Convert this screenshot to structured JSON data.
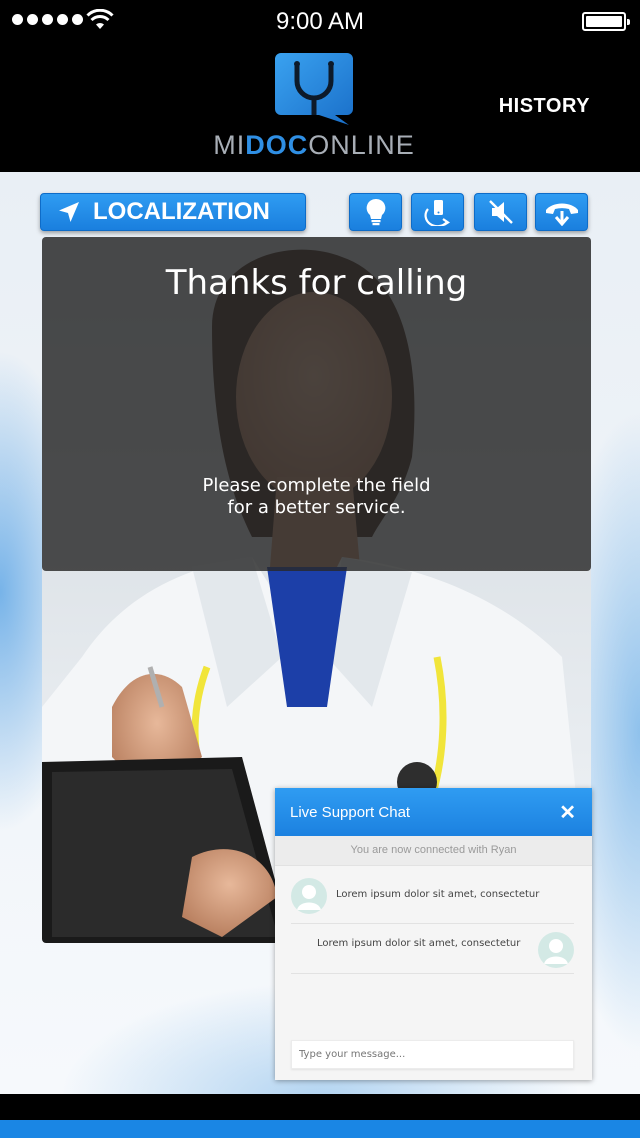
{
  "status_bar": {
    "time": "9:00 AM"
  },
  "header": {
    "logo_parts": [
      "MI",
      "DOC",
      "ONLINE"
    ],
    "history_label": "HISTORY"
  },
  "toolbar": {
    "localization_label": "LOCALIZATION",
    "icons": [
      "lightbulb-icon",
      "phone-rotate-icon",
      "mute-icon",
      "hangup-icon"
    ]
  },
  "call_overlay": {
    "title": "Thanks for calling",
    "message_line1": "Please complete the field",
    "message_line2": "for a better service."
  },
  "chat": {
    "title": "Live Support Chat",
    "status": "You are now connected with Ryan",
    "messages": [
      {
        "text": "Lorem ipsum dolor sit amet, consectetur",
        "side": "left"
      },
      {
        "text": "Lorem ipsum dolor sit amet, consectetur",
        "side": "right"
      }
    ],
    "input_placeholder": "Type your message..."
  },
  "colors": {
    "accent": "#1f87e5",
    "overlay": "#2a2a2a",
    "avatar": "#d3e9e5"
  }
}
